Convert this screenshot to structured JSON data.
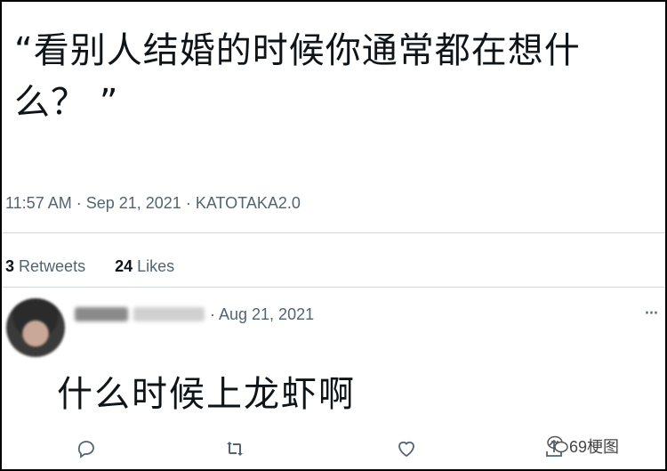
{
  "tweet": {
    "text": "“看别人结婚的时候你通常都在想什么？ ”",
    "time": "11:57 AM",
    "date": "Sep 21, 2021",
    "source": "KATOTAKA2.0",
    "separator": "·"
  },
  "stats": {
    "retweets_count": "3",
    "retweets_label": "Retweets",
    "likes_count": "24",
    "likes_label": "Likes"
  },
  "reply": {
    "date": "· Aug 21, 2021",
    "text": "什么时候上龙虾啊",
    "more": "···"
  },
  "icons": [
    "reply-icon",
    "retweet-icon",
    "like-icon",
    "share-icon"
  ],
  "watermark": {
    "text": "69梗图"
  },
  "colors": {
    "text": "#0f1419",
    "secondary": "#536471",
    "divider": "#cfd9de"
  }
}
